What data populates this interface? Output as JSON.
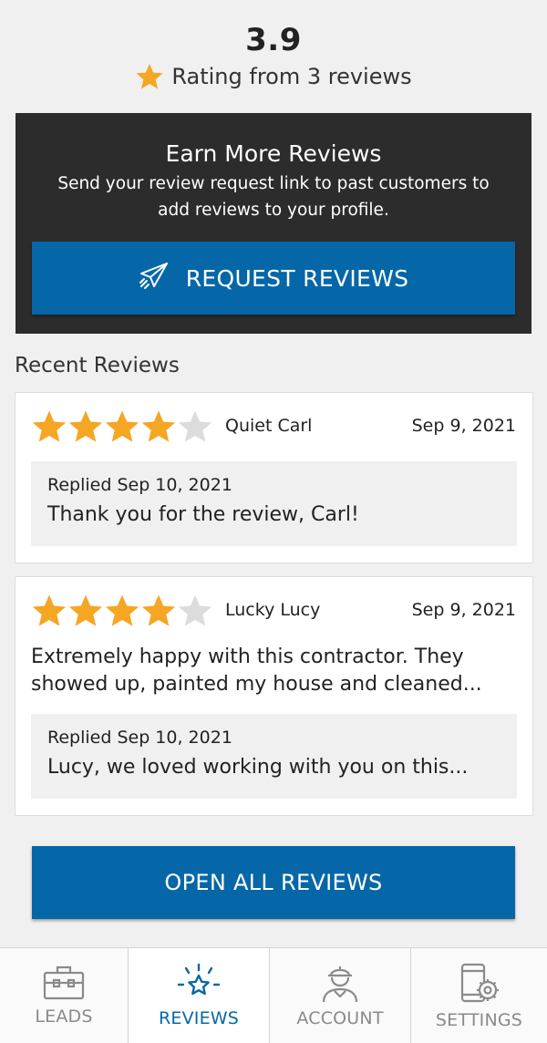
{
  "rating": {
    "value": "3.9",
    "caption": "Rating from 3 reviews",
    "star_color": "#f5a623"
  },
  "promo": {
    "title": "Earn More Reviews",
    "description": "Send your review request link to past customers to add reviews to your profile.",
    "button_label": "REQUEST REVIEWS",
    "button_icon": "paper-plane-icon"
  },
  "recent_reviews": {
    "title": "Recent Reviews",
    "items": [
      {
        "stars": 4,
        "max_stars": 5,
        "name": "Quiet Carl",
        "date": "Sep 9, 2021",
        "text": "",
        "reply_date": "Replied Sep 10, 2021",
        "reply_text": "Thank you for the review, Carl!"
      },
      {
        "stars": 4,
        "max_stars": 5,
        "name": "Lucky Lucy",
        "date": "Sep 9, 2021",
        "text": "Extremely happy with this contractor. They showed up, painted my house and cleaned...",
        "reply_date": "Replied Sep 10, 2021",
        "reply_text": "Lucy, we loved working with you on this..."
      }
    ]
  },
  "open_all_label": "OPEN ALL REVIEWS",
  "nav": {
    "items": [
      {
        "label": "LEADS",
        "icon": "toolbox-icon",
        "active": false
      },
      {
        "label": "REVIEWS",
        "icon": "sparkle-star-icon",
        "active": true
      },
      {
        "label": "ACCOUNT",
        "icon": "worker-icon",
        "active": false
      },
      {
        "label": "SETTINGS",
        "icon": "phone-gear-icon",
        "active": false
      }
    ]
  },
  "colors": {
    "primary": "#0567a8",
    "star_filled": "#f5a623",
    "star_empty": "#dcdcdc",
    "promo_bg": "#2c2c2c",
    "nav_inactive": "#8a8a8a"
  }
}
